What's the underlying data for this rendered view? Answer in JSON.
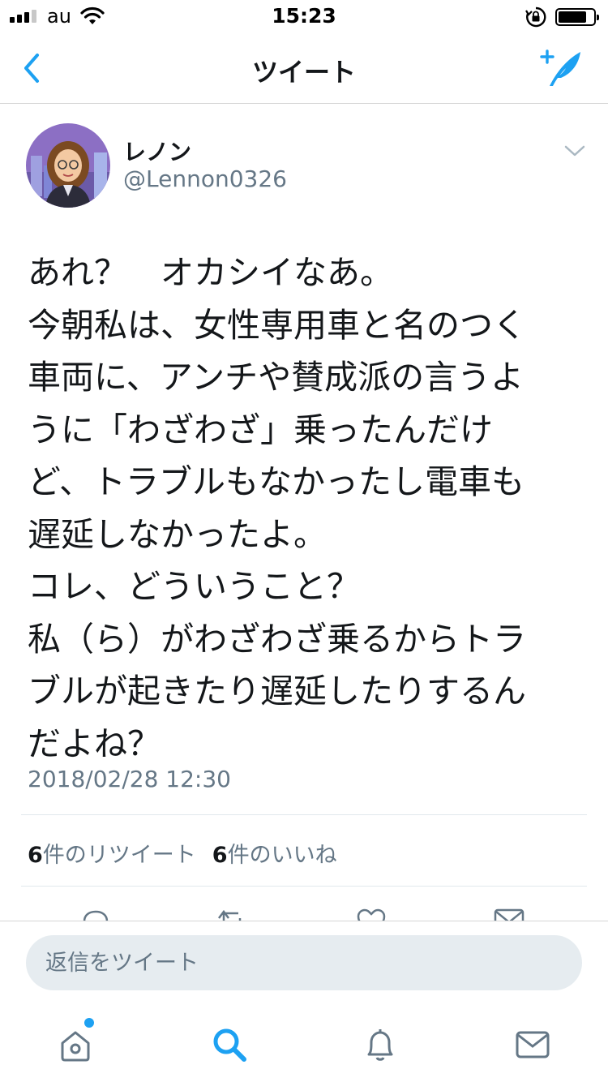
{
  "status_bar": {
    "carrier": "au",
    "time": "15:23"
  },
  "nav": {
    "title": "ツイート",
    "back_icon": "chevron-left-icon",
    "compose_icon": "compose-quill-icon"
  },
  "tweet": {
    "display_name": "レノン",
    "handle": "@Lennon0326",
    "text": "あれ？　オカシイなあ。\n今朝私は、女性専用車と名のつく\n車両に、アンチや賛成派の言うよ\nうに「わざわざ」乗ったんだけ\nど、トラブルもなかったし電車も\n遅延しなかったよ。\nコレ、どういうこと？\n私（ら）がわざわざ乗るからトラ\nブルが起きたり遅延したりするん\nだよね？",
    "timestamp": "2018/02/28 12:30",
    "retweet_count": "6",
    "retweet_label": "件のリツイート",
    "like_count": "6",
    "like_label": "件のいいね"
  },
  "reply": {
    "placeholder": "返信をツイート"
  },
  "tab_bar": {
    "items": [
      {
        "icon": "home-icon"
      },
      {
        "icon": "search-icon"
      },
      {
        "icon": "notifications-bell-icon"
      },
      {
        "icon": "messages-envelope-icon"
      }
    ]
  },
  "colors": {
    "accent": "#1da1f2",
    "text_primary": "#14171a",
    "text_secondary": "#657786",
    "divider": "#e1e8ed",
    "input_bg": "#e6ecf0"
  }
}
